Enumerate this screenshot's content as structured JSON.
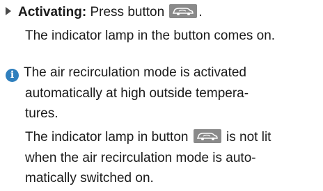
{
  "step": {
    "label": "Activating:",
    "text_before": "Press button",
    "text_after": ".",
    "result": "The indicator lamp in the button comes on."
  },
  "note": {
    "icon": "info-icon",
    "line1": "The air recirculation mode is activated",
    "line2": "automatically at high outside tempera-",
    "line3": "tures.",
    "line4_before": "The indicator lamp in button",
    "line4_after": "is not lit",
    "line5": "when the air recirculation mode is auto-",
    "line6": "matically switched on."
  },
  "colors": {
    "text": "#1a1a1a",
    "info_icon": "#2f7fbd",
    "button_bg": "#8a8a8a"
  }
}
